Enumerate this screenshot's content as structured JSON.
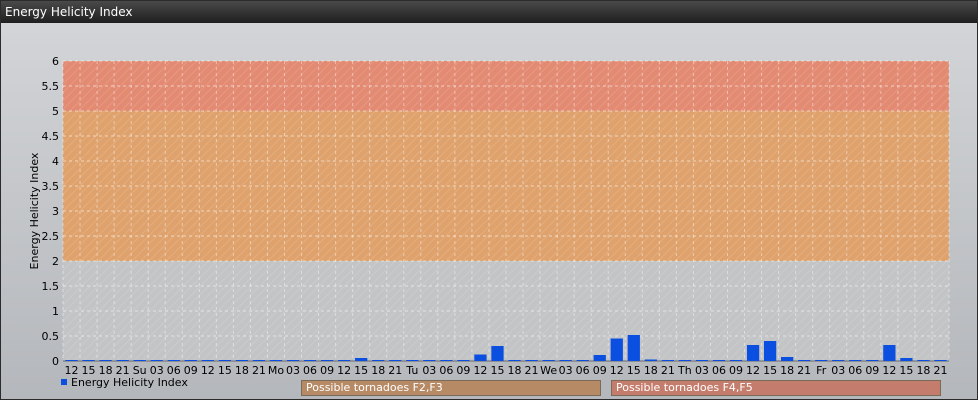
{
  "window": {
    "title": "Energy Helicity Index"
  },
  "chart_data": {
    "type": "bar",
    "ylabel": "Energy Helicity Index",
    "ylim": [
      0,
      6
    ],
    "yticks": [
      "0",
      "0.5",
      "1",
      "1.5",
      "2",
      "2.5",
      "3",
      "3.5",
      "4",
      "4.5",
      "5",
      "5.5",
      "6"
    ],
    "categories": [
      "12",
      "15",
      "18",
      "21",
      "Su",
      "03",
      "06",
      "09",
      "12",
      "15",
      "18",
      "21",
      "Mo",
      "03",
      "06",
      "09",
      "12",
      "15",
      "18",
      "21",
      "Tu",
      "03",
      "06",
      "09",
      "12",
      "15",
      "18",
      "21",
      "We",
      "03",
      "06",
      "09",
      "12",
      "15",
      "18",
      "21",
      "Th",
      "03",
      "06",
      "09",
      "12",
      "15",
      "18",
      "21",
      "Fr",
      "03",
      "06",
      "09",
      "12",
      "15",
      "18",
      "21"
    ],
    "series": [
      {
        "name": "Energy Helicity Index",
        "color": "#0b4fe0",
        "values": [
          0.01,
          0.01,
          0.01,
          0.01,
          0.01,
          0.01,
          0.01,
          0.01,
          0.01,
          0.01,
          0.01,
          0.01,
          0.01,
          0.01,
          0.01,
          0.01,
          0.01,
          0.06,
          0.01,
          0.01,
          0.01,
          0.01,
          0.01,
          0.01,
          0.13,
          0.3,
          0.01,
          0.01,
          0.01,
          0.01,
          0.01,
          0.12,
          0.45,
          0.52,
          0.03,
          0.01,
          0.01,
          0.01,
          0.01,
          0.01,
          0.32,
          0.4,
          0.08,
          0.01,
          0.01,
          0.01,
          0.01,
          0.01,
          0.32,
          0.06,
          0.01,
          0.01
        ]
      }
    ],
    "bands": [
      {
        "from": 0,
        "to": 2,
        "color": "#c2c4c6"
      },
      {
        "from": 2,
        "to": 5,
        "color": "#dfa26c"
      },
      {
        "from": 5,
        "to": 6,
        "color": "#e38a72"
      }
    ],
    "legend": "bottom-left",
    "grid": true
  },
  "zones": [
    {
      "label": "Possible tornadoes F2,F3",
      "color": "#b78a66"
    },
    {
      "label": "Possible tornadoes F4,F5",
      "color": "#c47d6c"
    }
  ]
}
